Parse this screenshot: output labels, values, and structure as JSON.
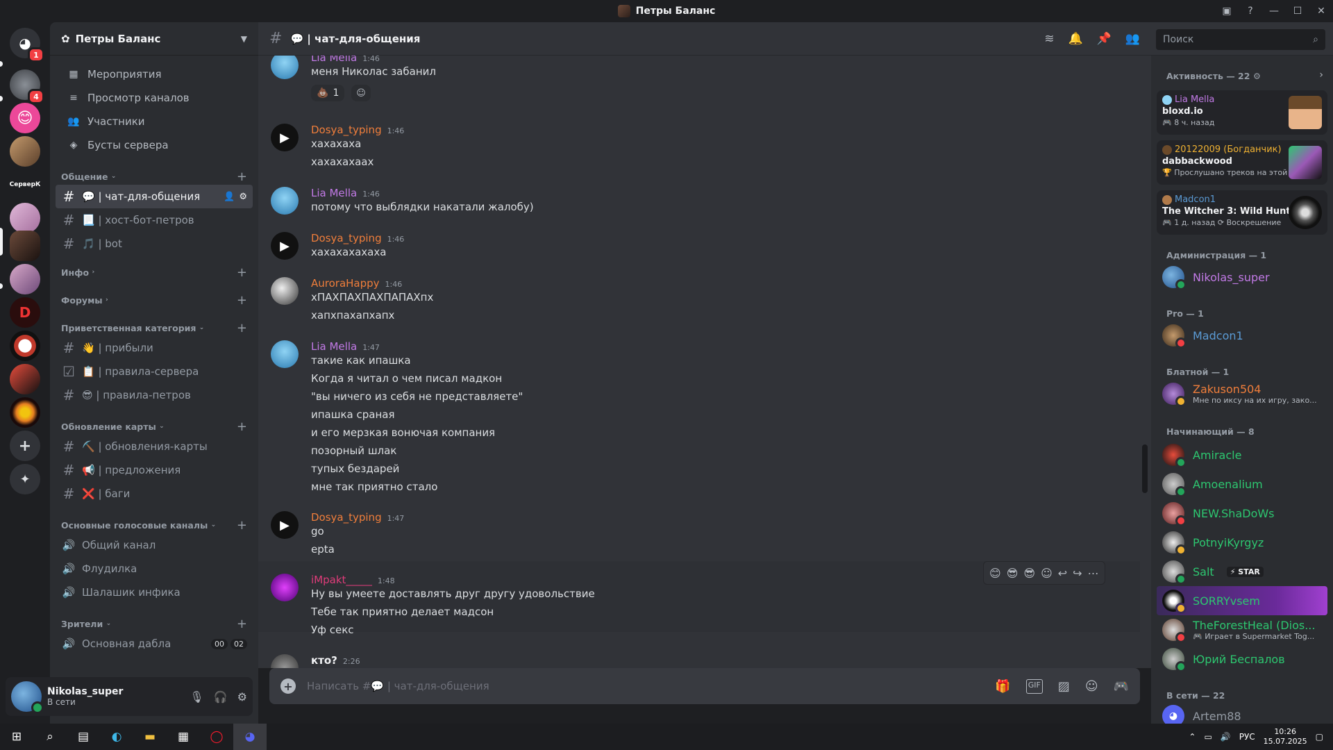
{
  "window": {
    "title": "Петры Баланс"
  },
  "guild": {
    "name": "Петры Баланс"
  },
  "nav": [
    {
      "icon": "calendar-icon",
      "glyph": "▦",
      "label": "Мероприятия"
    },
    {
      "icon": "browse-channels-icon",
      "glyph": "≡",
      "label": "Просмотр каналов"
    },
    {
      "icon": "members-icon",
      "glyph": "👥",
      "label": "Участники"
    },
    {
      "icon": "boost-icon",
      "glyph": "◈",
      "label": "Бусты сервера"
    }
  ],
  "categories": {
    "obshenie": "Общение",
    "info": "Инфо",
    "forums": "Форумы",
    "welcome": "Приветственная категория",
    "map": "Обновление карты",
    "voice": "Основные голосовые каналы",
    "viewers": "Зрители"
  },
  "channels": {
    "chat": "💬 | чат-для-общения",
    "hostbot": "📃 | хост-бот-петров",
    "bot": "🎵 | bot",
    "arrived": "👋 | прибыли",
    "rules_server": "📋 | правила-сервера",
    "rules_petrov": "😎 | правила-петров",
    "map_updates": "⛏️ | обновления-карты",
    "suggestions": "📢 | предложения",
    "bugs": "❌ | баги",
    "voice_general": "Общий канал",
    "voice_flood": "Флудилка",
    "voice_shalash": "Шалашик инфика",
    "voice_main": "Основная дабла",
    "voice_main_counts": [
      "00",
      "02"
    ]
  },
  "user": {
    "name": "Nikolas_super",
    "status": "В сети"
  },
  "chat_header": {
    "name": "💬 | чат-для-общения"
  },
  "search": {
    "placeholder": "Поиск"
  },
  "messages": [
    {
      "author": "Lia Mella",
      "color": "#c27ae6",
      "time": "1:46",
      "lines": [
        "меня Николас забанил"
      ],
      "reaction": {
        "emoji": "💩",
        "count": "1"
      }
    },
    {
      "author": "Dosya_typing",
      "color": "#f07e3b",
      "time": "1:46",
      "lines": [
        "хахахаха",
        "хахахахаах"
      ]
    },
    {
      "author": "Lia Mella",
      "color": "#c27ae6",
      "time": "1:46",
      "lines": [
        "потому что выблядки накатали жалобу)"
      ]
    },
    {
      "author": "Dosya_typing",
      "color": "#f07e3b",
      "time": "1:46",
      "lines": [
        "хахахахахаха"
      ]
    },
    {
      "author": "AuroraHappy",
      "color": "#f07e3b",
      "time": "1:46",
      "lines": [
        "хПАХПАХПАХПАПАХпх",
        "хапхпахапхапх"
      ]
    },
    {
      "author": "Lia Mella",
      "color": "#c27ae6",
      "time": "1:47",
      "lines": [
        "такие как ипашка",
        "Когда я читал о чем писал мадкон",
        "\"вы ничего из себя не представляете\"",
        "ипашка сраная",
        "и его мерзкая вонючая компания",
        "позорный шлак",
        "тупых бездарей",
        "мне так приятно стало"
      ]
    },
    {
      "author": "Dosya_typing",
      "color": "#f07e3b",
      "time": "1:47",
      "lines": [
        "go",
        "epta"
      ]
    },
    {
      "author": "iMpakt_____",
      "color": "#e03c7a",
      "time": "1:48",
      "lines": [
        "Ну вы умеете доставлять друг другу удовольствие",
        "Тебе так приятно делает мадсон",
        "Уф секс"
      ]
    },
    {
      "author": "кто?",
      "color": "#f2f3f5",
      "time": "2:26",
      "lines": []
    }
  ],
  "composer": {
    "placeholder": "Написать #💬 | чат-для-общения"
  },
  "members": {
    "activity_title": "Активность — 22",
    "activities": [
      {
        "name": "Lia Mella",
        "color": "#c27ae6",
        "game": "bloxd.io",
        "sub": "🎮 8 ч. назад"
      },
      {
        "name": "20122009 (Богданчик)",
        "color": "#f0b232",
        "game": "dabbackwood",
        "sub": "🏆 Прослушано треков на этой..."
      },
      {
        "name": "Madcon1",
        "color": "#5b9bd5",
        "game": "The Witcher 3: Wild Hunt",
        "sub": "🎮 1 д. назад  ⟳ Воскрешение"
      }
    ],
    "groups": [
      {
        "title": "Администрация — 1",
        "list": [
          {
            "name": "Nikolas_super",
            "color": "#c27ae6",
            "status": "#23a55a"
          }
        ]
      },
      {
        "title": "Pro — 1",
        "list": [
          {
            "name": "Madcon1",
            "color": "#5b9bd5",
            "status": "#f23f43"
          }
        ]
      },
      {
        "title": "Блатной — 1",
        "list": [
          {
            "name": "Zakuson504",
            "color": "#f07e3b",
            "status": "#f0b232",
            "sub": "Мне по иксу на их игру, зако..."
          }
        ]
      },
      {
        "title": "Начинающий — 8",
        "list": [
          {
            "name": "Amiracle",
            "color": "#2dc770",
            "status": "#23a55a"
          },
          {
            "name": "Amoenalium",
            "color": "#2dc770",
            "status": "#23a55a"
          },
          {
            "name": "NEW.ShaDoWs",
            "color": "#2dc770",
            "status": "#f23f43"
          },
          {
            "name": "PotnyiKyrgyz",
            "color": "#2dc770",
            "status": "#f0b232"
          },
          {
            "name": "Salt",
            "color": "#2dc770",
            "status": "#23a55a",
            "tag": "⚡ STAR"
          },
          {
            "name": "SORRYvsem",
            "color": "#2dc770",
            "status": "#f0b232"
          },
          {
            "name": "TheForestHeal (Dios...",
            "color": "#2dc770",
            "status": "#f23f43",
            "sub": "🎮 Играет в Supermarket Tog..."
          },
          {
            "name": "Юрий Беспалов",
            "color": "#2dc770",
            "status": "#23a55a"
          }
        ]
      },
      {
        "title": "В сети — 22",
        "list": [
          {
            "name": "Artem88",
            "color": "#949ba4",
            "status": "#23a55a"
          }
        ]
      }
    ]
  },
  "server_label": "СерверК",
  "badges": {
    "home": "1",
    "server1": "4"
  },
  "taskbar": {
    "lang": "РУС",
    "time": "10:26",
    "date": "15.07.2025"
  }
}
